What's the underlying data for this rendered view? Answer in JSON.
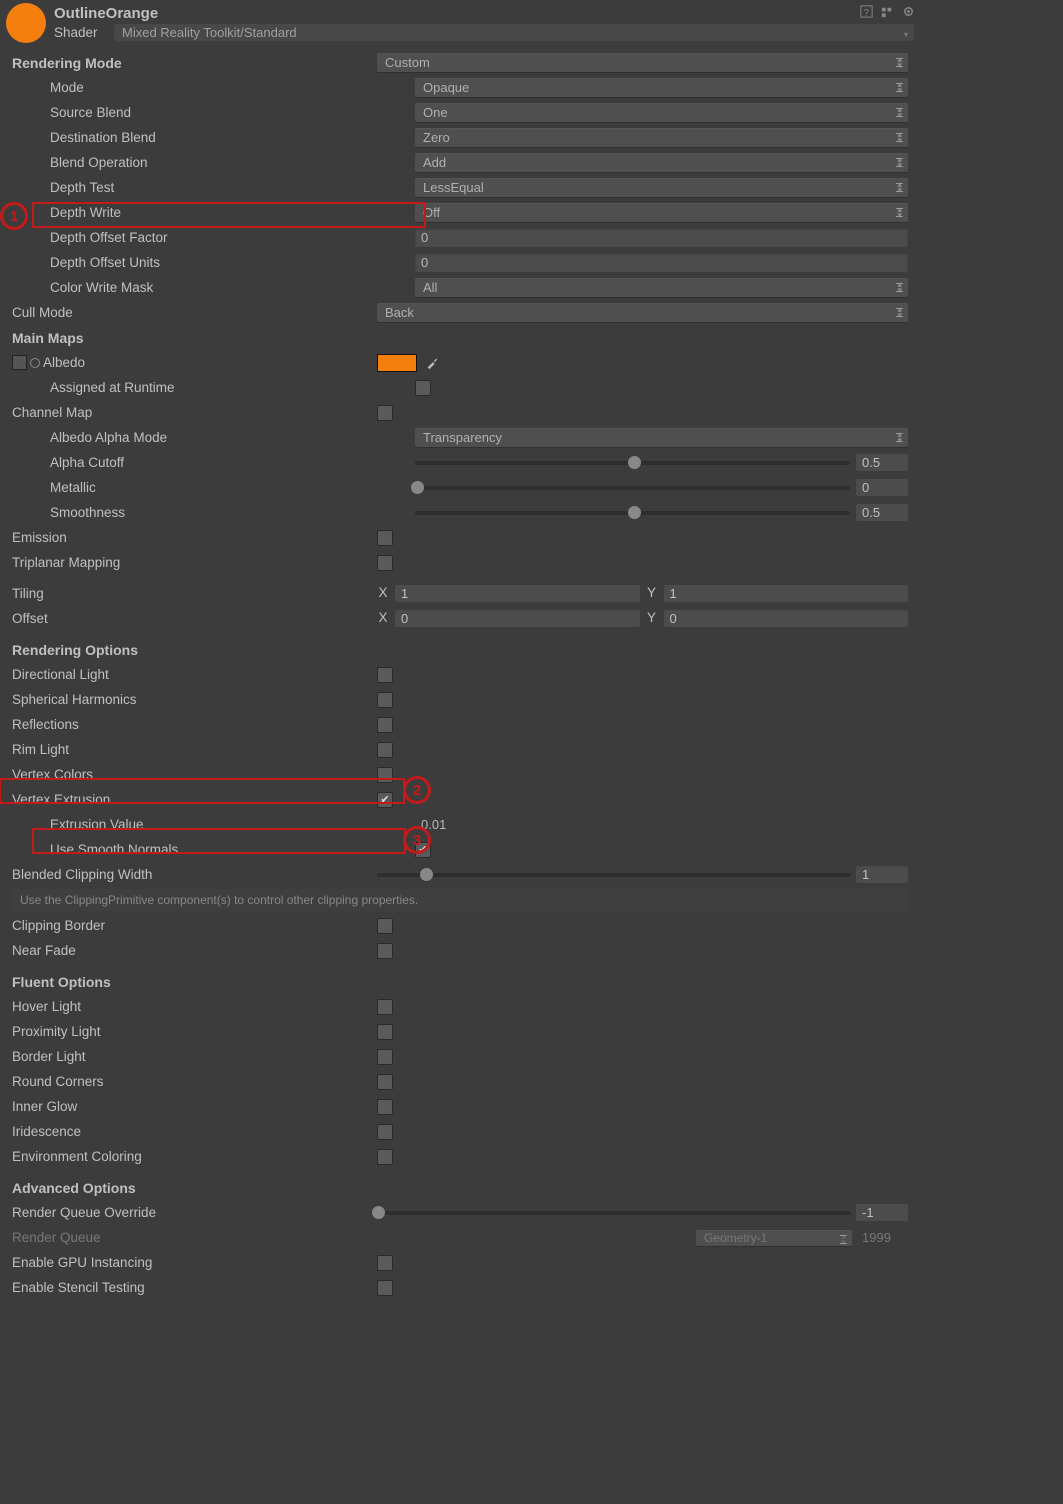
{
  "header": {
    "material_name": "OutlineOrange",
    "shader_label": "Shader",
    "shader_value": "Mixed Reality Toolkit/Standard"
  },
  "rendering_mode": {
    "title": "Rendering Mode",
    "value": "Custom",
    "mode_label": "Mode",
    "mode_value": "Opaque",
    "src_label": "Source Blend",
    "src_value": "One",
    "dst_label": "Destination Blend",
    "dst_value": "Zero",
    "op_label": "Blend Operation",
    "op_value": "Add",
    "dtest_label": "Depth Test",
    "dtest_value": "LessEqual",
    "dwrite_label": "Depth Write",
    "dwrite_value": "Off",
    "dof_label": "Depth Offset Factor",
    "dof_value": "0",
    "dou_label": "Depth Offset Units",
    "dou_value": "0",
    "cwm_label": "Color Write Mask",
    "cwm_value": "All",
    "cull_label": "Cull Mode",
    "cull_value": "Back"
  },
  "main_maps": {
    "title": "Main Maps",
    "albedo_label": "Albedo",
    "air_label": "Assigned at Runtime",
    "chan_label": "Channel Map",
    "aam_label": "Albedo Alpha Mode",
    "aam_value": "Transparency",
    "ac_label": "Alpha Cutoff",
    "ac_value": "0.5",
    "ac_thumb": 50,
    "mt_label": "Metallic",
    "mt_value": "0",
    "mt_thumb": 0,
    "sm_label": "Smoothness",
    "sm_value": "0.5",
    "sm_thumb": 50,
    "em_label": "Emission",
    "tp_label": "Triplanar Mapping",
    "til_label": "Tiling",
    "til_x": "1",
    "til_y": "1",
    "off_label": "Offset",
    "off_x": "0",
    "off_y": "0"
  },
  "rendering_options": {
    "title": "Rendering Options",
    "dl_label": "Directional Light",
    "sh_label": "Spherical Harmonics",
    "rf_label": "Reflections",
    "rl_label": "Rim Light",
    "vc_label": "Vertex Colors",
    "ve_label": "Vertex Extrusion",
    "ve_on": true,
    "ev_label": "Extrusion Value",
    "ev_value": "0.01",
    "usn_label": "Use Smooth Normals",
    "usn_on": true,
    "bcw_label": "Blended Clipping Width",
    "bcw_value": "1",
    "bcw_thumb": 10,
    "note": "Use the ClippingPrimitive component(s) to control other clipping properties.",
    "cb_label": "Clipping Border",
    "nf_label": "Near Fade"
  },
  "fluent_options": {
    "title": "Fluent Options",
    "hl_label": "Hover Light",
    "pl_label": "Proximity Light",
    "bl_label": "Border Light",
    "rc_label": "Round Corners",
    "ig_label": "Inner Glow",
    "ir_label": "Iridescence",
    "ec_label": "Environment Coloring"
  },
  "advanced_options": {
    "title": "Advanced Options",
    "rqo_label": "Render Queue Override",
    "rqo_value": "-1",
    "rqo_thumb": 0,
    "rq_label": "Render Queue",
    "rq_dd": "Geometry-1",
    "rq_value": "1999",
    "gpu_label": "Enable GPU Instancing",
    "st_label": "Enable Stencil Testing"
  }
}
